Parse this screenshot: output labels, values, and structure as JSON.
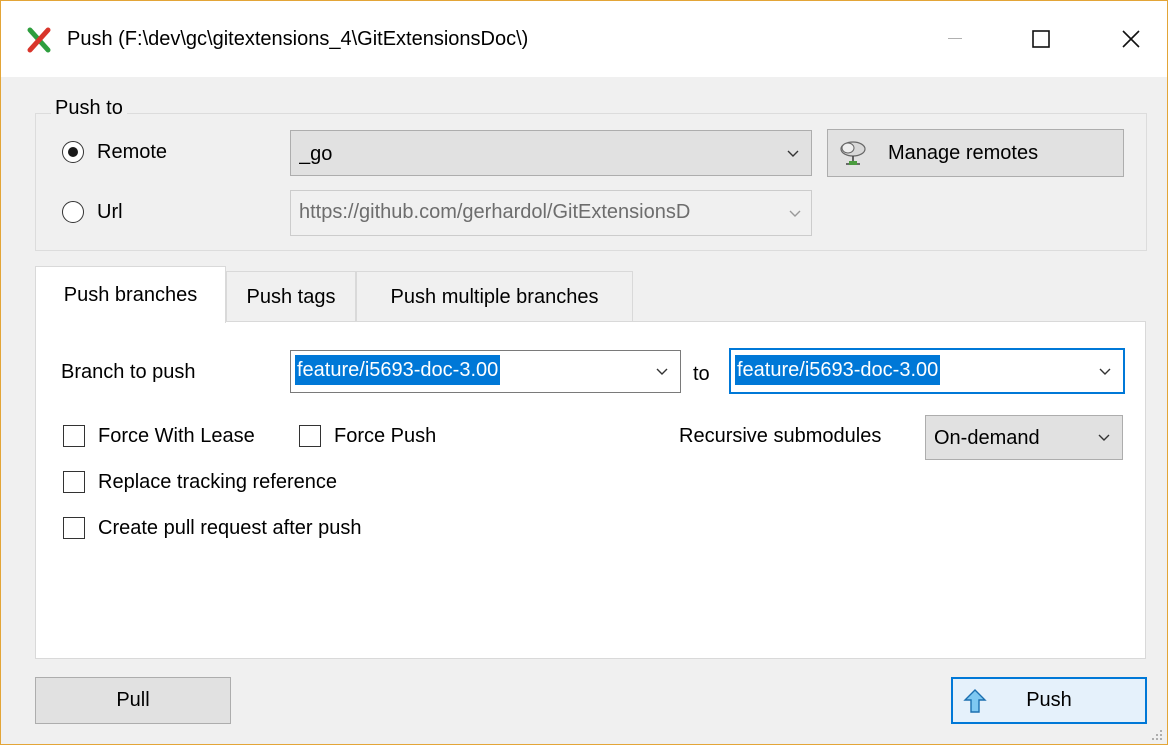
{
  "window": {
    "title": "Push (F:\\dev\\gc\\gitextensions_4\\GitExtensionsDoc\\)",
    "icon": "gitextensions-app-icon"
  },
  "push_to": {
    "group_label": "Push to",
    "remote_label": "Remote",
    "remote_selected": true,
    "remote_value": "_go",
    "url_label": "Url",
    "url_value": "https://github.com/gerhardol/GitExtensionsD",
    "manage_remotes_label": "Manage remotes"
  },
  "tabs": [
    {
      "label": "Push branches",
      "active": true
    },
    {
      "label": "Push tags",
      "active": false
    },
    {
      "label": "Push multiple branches",
      "active": false
    }
  ],
  "branches": {
    "branch_to_push_label": "Branch to push",
    "branch_value": "feature/i5693-doc-3.00",
    "to_label": "to",
    "target_value": "feature/i5693-doc-3.00",
    "force_with_lease_label": "Force With Lease",
    "force_push_label": "Force Push",
    "replace_tracking_label": "Replace tracking reference",
    "create_pr_label": "Create pull request after push",
    "recursive_label": "Recursive submodules",
    "recursive_value": "On-demand"
  },
  "footer": {
    "pull_label": "Pull",
    "push_label": "Push"
  },
  "colors": {
    "selection": "#0078d7",
    "focus_border": "#0078d7",
    "window_border": "#e3a537"
  }
}
